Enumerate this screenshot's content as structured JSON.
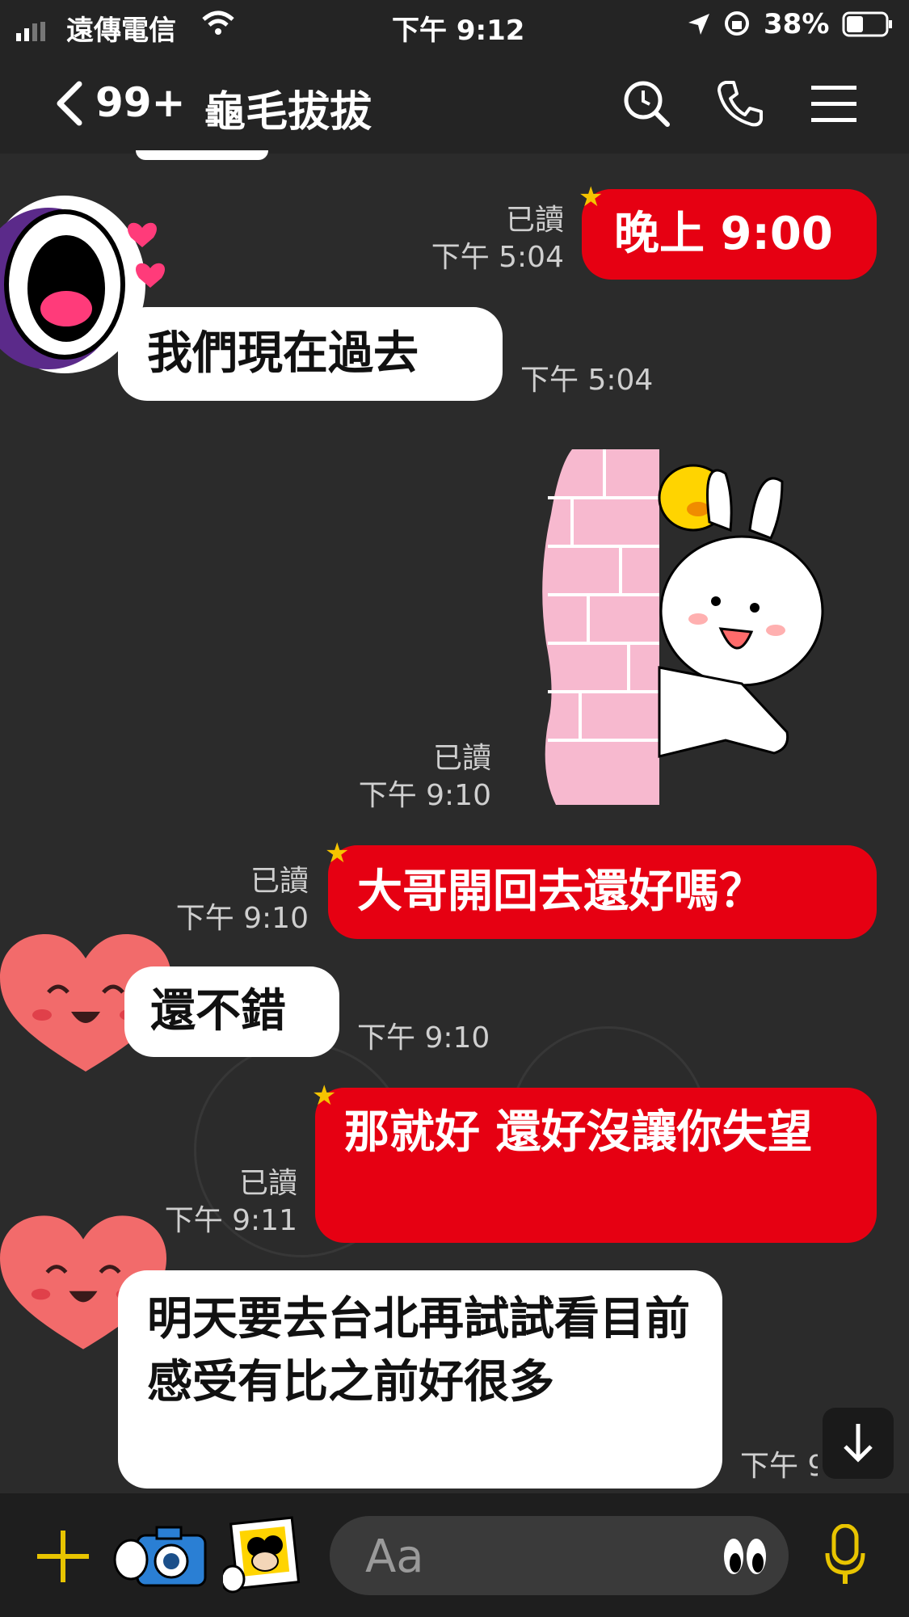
{
  "status_bar": {
    "carrier": "遠傳電信",
    "time": "下午 9:12",
    "battery": "38%"
  },
  "header": {
    "back_count": "99+",
    "title": "龜毛拔拔"
  },
  "messages": [
    {
      "direction": "out",
      "text": "晚上 9:00",
      "read": "已讀",
      "time": "下午 5:04"
    },
    {
      "direction": "in",
      "text": "我們現在過去",
      "time": "下午 5:04"
    },
    {
      "direction": "out",
      "type": "sticker",
      "sticker": "brown-cony-sally-peek",
      "read": "已讀",
      "time": "下午 9:10"
    },
    {
      "direction": "out",
      "text": "大哥開回去還好嗎？",
      "read": "已讀",
      "time": "下午 9:10"
    },
    {
      "direction": "in",
      "text": "還不錯",
      "time": "下午 9:10"
    },
    {
      "direction": "out",
      "text": "那就好 還好沒讓你失望",
      "read": "已讀",
      "time": "下午 9:11"
    },
    {
      "direction": "in",
      "text": "明天要去台北再試試看目前感受有比之前好很多",
      "time": "下午 9:11"
    }
  ],
  "input": {
    "placeholder": "Aa"
  },
  "colors": {
    "out_bubble": "#e60012",
    "in_bubble": "#ffffff",
    "accent_icon": "#e8c400",
    "background": "#2b2b2b"
  },
  "icons": [
    "back-icon",
    "search-icon",
    "phone-icon",
    "menu-icon",
    "plus-icon",
    "camera-icon",
    "image-icon",
    "emoji-icon",
    "mic-icon",
    "scroll-down-icon"
  ]
}
